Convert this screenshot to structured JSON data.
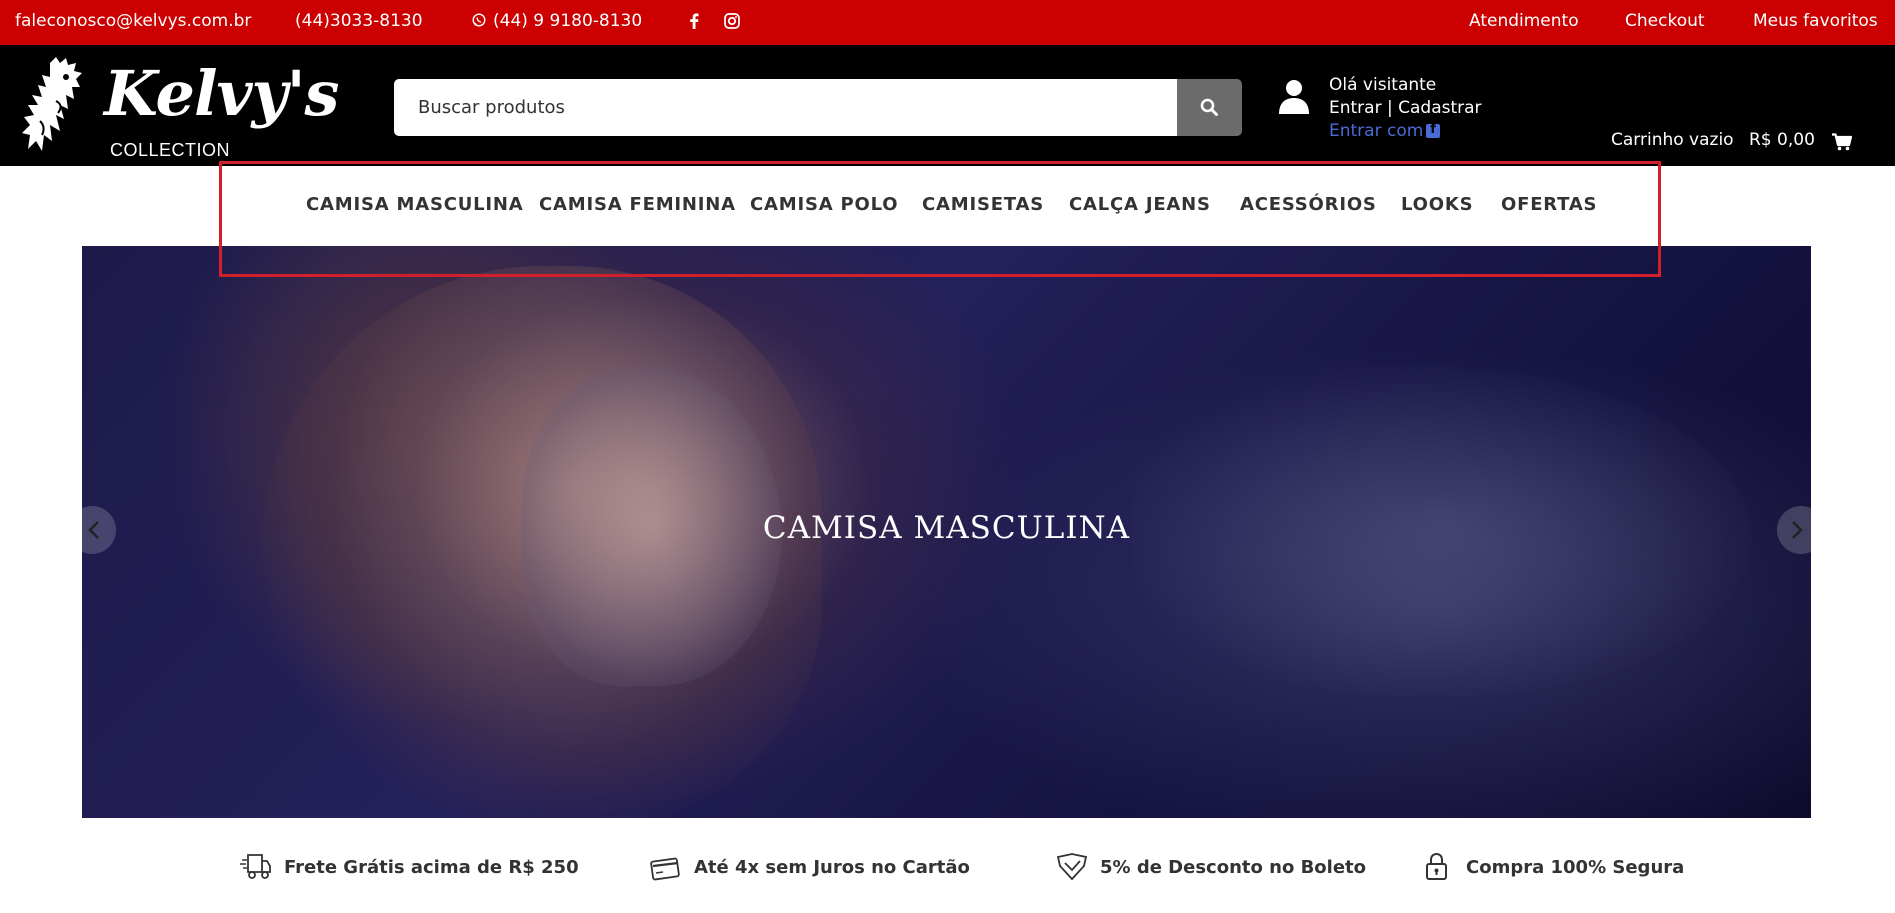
{
  "topbar": {
    "email": "faleconosco@kelvys.com.br",
    "phone": "(44)3033-8130",
    "whatsapp": "(44) 9 9180-8130",
    "links": [
      "Atendimento",
      "Checkout",
      "Meus favoritos"
    ],
    "background": "#cc0000"
  },
  "logo": {
    "brand": "Kelvy's",
    "sub": "COLLECTION"
  },
  "search": {
    "placeholder": "Buscar produtos"
  },
  "account": {
    "greeting": "Olá visitante",
    "login": "Entrar | Cadastrar",
    "facebook": "Entrar com"
  },
  "cart": {
    "label": "Carrinho vazio",
    "total": "R$ 0,00"
  },
  "nav": {
    "items": [
      "CAMISA MASCULINA",
      "CAMISA FEMININA",
      "CAMISA POLO",
      "CAMISETAS",
      "CALÇA JEANS",
      "ACESSÓRIOS",
      "LOOKS",
      "OFERTAS"
    ]
  },
  "banner": {
    "caption": "CAMISA MASCULINA"
  },
  "features": [
    {
      "icon": "truck-icon",
      "text": "Frete Grátis acima de R$ 250"
    },
    {
      "icon": "card-icon",
      "text": "Até 4x sem Juros no Cartão"
    },
    {
      "icon": "tag-icon",
      "text": "5% de Desconto no Boleto"
    },
    {
      "icon": "lock-icon",
      "text": "Compra 100% Segura"
    }
  ],
  "colors": {
    "highlight": "#d21f2c",
    "search_button": "#6b6b6b",
    "facebook_link": "#4a6bd6"
  }
}
